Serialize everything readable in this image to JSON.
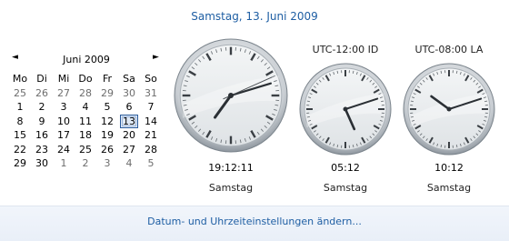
{
  "heading": "Samstag, 13. Juni 2009",
  "calendar": {
    "month_label": "Juni 2009",
    "prev_glyph": "◄",
    "next_glyph": "►",
    "weekdays": [
      "Mo",
      "Di",
      "Mi",
      "Do",
      "Fr",
      "Sa",
      "So"
    ],
    "weeks": [
      [
        "25",
        "26",
        "27",
        "28",
        "29",
        "30",
        "31"
      ],
      [
        "1",
        "2",
        "3",
        "4",
        "5",
        "6",
        "7"
      ],
      [
        "8",
        "9",
        "10",
        "11",
        "12",
        "13",
        "14"
      ],
      [
        "15",
        "16",
        "17",
        "18",
        "19",
        "20",
        "21"
      ],
      [
        "22",
        "23",
        "24",
        "25",
        "26",
        "27",
        "28"
      ],
      [
        "29",
        "30",
        "1",
        "2",
        "3",
        "4",
        "5"
      ]
    ],
    "today": "13"
  },
  "clocks": [
    {
      "label": "",
      "time": "19:12:11",
      "day": "Samstag",
      "hour": 19,
      "minute": 12,
      "second": 11
    },
    {
      "label": "UTC-12:00 ID",
      "time": "05:12",
      "day": "Samstag",
      "hour": 5,
      "minute": 12
    },
    {
      "label": "UTC-08:00 LA",
      "time": "10:12",
      "day": "Samstag",
      "hour": 10,
      "minute": 12
    }
  ],
  "footer": {
    "link": "Datum- und Uhrzeiteinstellungen ändern..."
  }
}
